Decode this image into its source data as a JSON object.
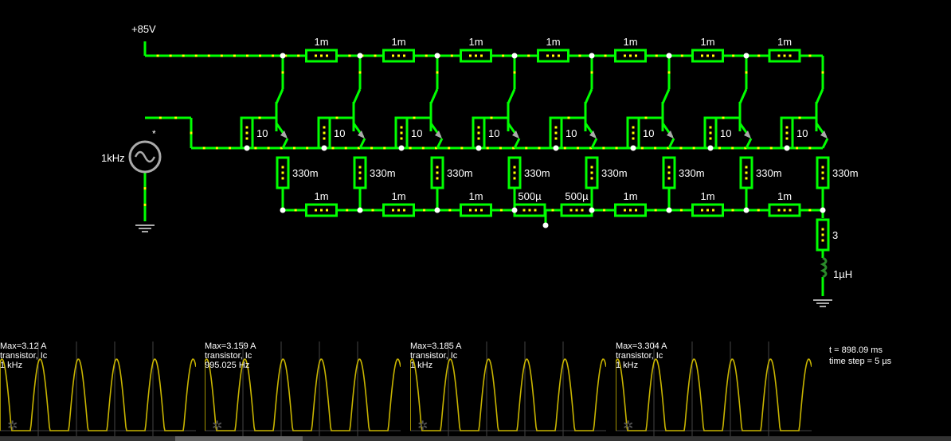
{
  "colors": {
    "wire": "#00ff00",
    "dot": "#ffff00",
    "node": "#ffffff",
    "trace": "#c8b400",
    "grid": "#444444"
  },
  "circuit": {
    "supply_label": "+85V",
    "source_label": "1kHz",
    "source_marker": "*",
    "top_resistor_labels": [
      "1m",
      "1m",
      "1m",
      "1m",
      "1m",
      "1m",
      "1m"
    ],
    "base_resistor_labels": [
      "10",
      "10",
      "10",
      "10",
      "10",
      "10",
      "10",
      "10"
    ],
    "emitter_resistor_labels": [
      "330m",
      "330m",
      "330m",
      "330m",
      "330m",
      "330m",
      "330m",
      "330m"
    ],
    "bottom_resistor_labels": [
      "1m",
      "1m",
      "1m",
      "500µ",
      "500µ",
      "1m",
      "1m",
      "1m"
    ],
    "load_resistor_label": "3",
    "inductor_label": "1µH"
  },
  "scopes": [
    {
      "max": "Max=3.12 A",
      "name": "transistor, Ic",
      "freq": "1 kHz"
    },
    {
      "max": "Max=3.159 A",
      "name": "transistor, Ic",
      "freq": "995.025 Hz"
    },
    {
      "max": "Max=3.185 A",
      "name": "transistor, Ic",
      "freq": "1 kHz"
    },
    {
      "max": "Max=3.304 A",
      "name": "transistor, Ic",
      "freq": "1 kHz"
    }
  ],
  "sim": {
    "time": "t = 898.09 ms",
    "step": "time step = 5 µs"
  },
  "icons": {
    "settings": "gear-icon"
  }
}
